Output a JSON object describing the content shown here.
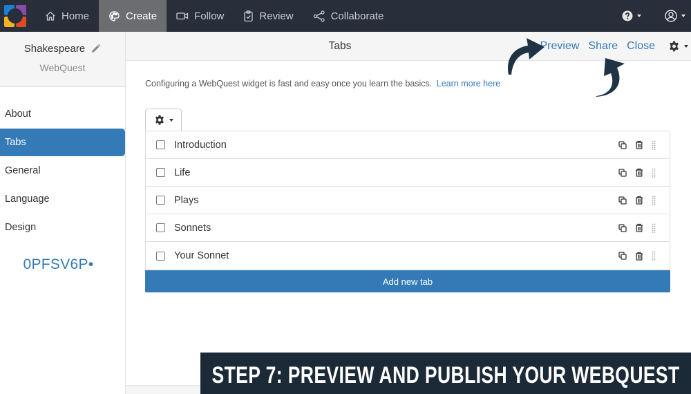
{
  "topnav": {
    "items": [
      {
        "label": "Home",
        "icon": "home-icon",
        "active": false
      },
      {
        "label": "Create",
        "icon": "palette-icon",
        "active": true
      },
      {
        "label": "Follow",
        "icon": "video-icon",
        "active": false
      },
      {
        "label": "Review",
        "icon": "clipboard-check-icon",
        "active": false
      },
      {
        "label": "Collaborate",
        "icon": "share-nodes-icon",
        "active": false
      }
    ],
    "help_icon": "question-circle-icon",
    "user_icon": "user-circle-icon"
  },
  "sidebar": {
    "title": "Shakespeare",
    "subtitle": "WebQuest",
    "menu": [
      {
        "label": "About",
        "active": false
      },
      {
        "label": "Tabs",
        "active": true
      },
      {
        "label": "General",
        "active": false
      },
      {
        "label": "Language",
        "active": false
      },
      {
        "label": "Design",
        "active": false
      }
    ],
    "code": "0PFSV6P•"
  },
  "header": {
    "title": "Tabs",
    "actions": {
      "preview": "Preview",
      "share": "Share",
      "close": "Close"
    }
  },
  "main": {
    "intro_text": "Configuring a WebQuest widget is fast and easy once you learn the basics.",
    "learn_more": "Learn more here",
    "tabs": [
      {
        "label": "Introduction",
        "checked": false
      },
      {
        "label": "Life",
        "checked": false
      },
      {
        "label": "Plays",
        "checked": false
      },
      {
        "label": "Sonnets",
        "checked": false
      },
      {
        "label": "Your Sonnet",
        "checked": false
      }
    ],
    "add_tab_label": "Add new tab"
  },
  "banner": {
    "text": "STEP 7: PREVIEW AND PUBLISH YOUR WEBQUEST"
  },
  "colors": {
    "nav_bg": "#282f3b",
    "accent": "#337ab7",
    "banner_bg": "#1c2a38",
    "arrow": "#1f3344"
  }
}
